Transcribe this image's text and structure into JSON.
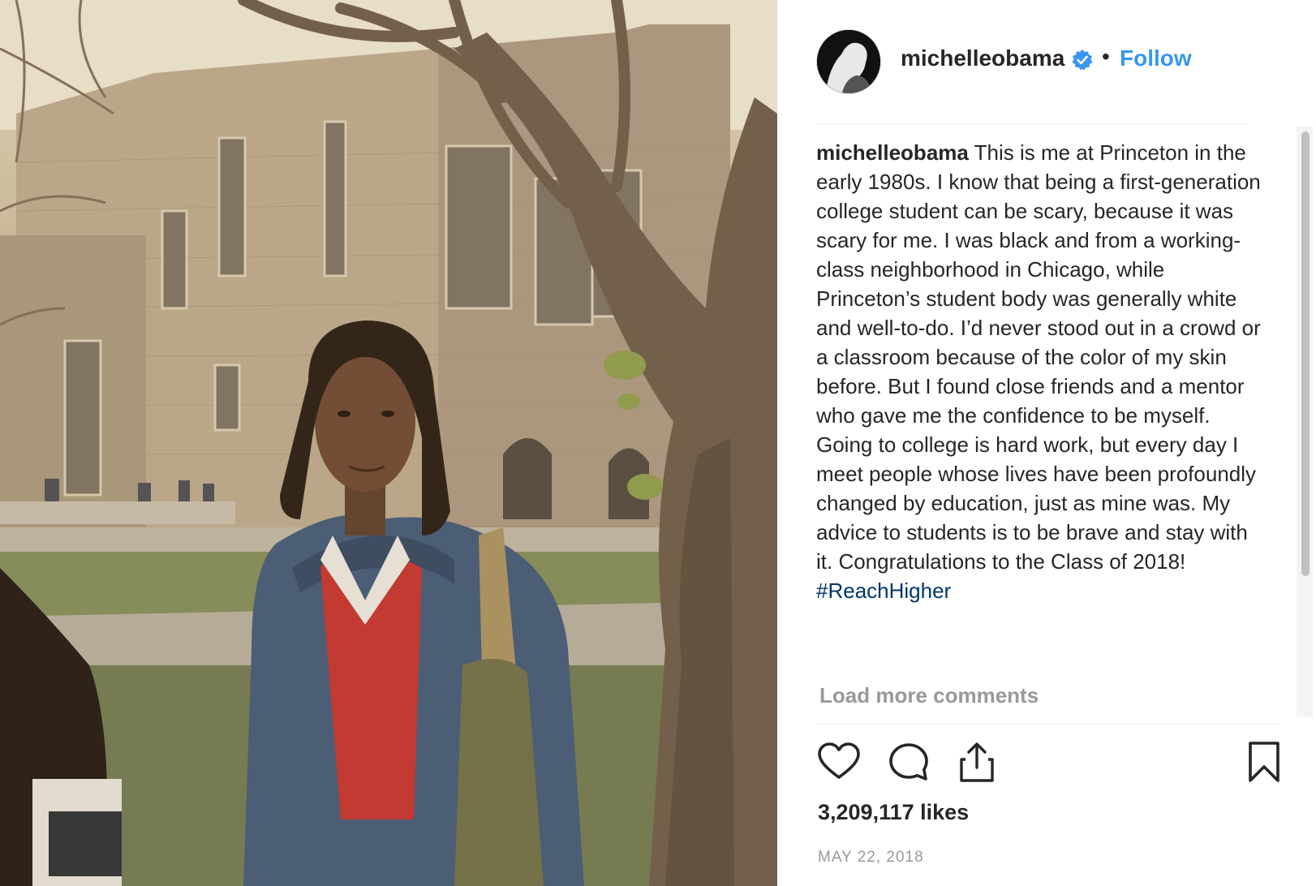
{
  "post": {
    "username": "michelleobama",
    "separator": "•",
    "follow_label": "Follow",
    "caption_user": "michelleobama",
    "caption_text": "This is me at Princeton in the early 1980s. I know that being a first-generation college student can be scary, because it was scary for me. I was black and from a working-class neighborhood in Chicago, while Princeton’s student body was generally white and well-to-do. I’d never stood out in a crowd or a classroom because of the color of my skin before. But I found close friends and a mentor who gave me the confidence to be myself. Going to college is hard work, but every day I meet people whose lives have been profoundly changed by education, just as mine was. My advice to students is to be brave and stay with it. Congratulations to the Class of 2018!",
    "hashtag": "#ReachHigher",
    "load_more_label": "Load more comments",
    "likes": "3,209,117 likes",
    "date": "MAY 22, 2018"
  },
  "icons": {
    "verified": "verified-badge-icon",
    "like": "heart-icon",
    "comment": "comment-bubble-icon",
    "share": "share-icon",
    "save": "bookmark-icon"
  },
  "colors": {
    "accent": "#3897f0",
    "text": "#262626",
    "muted": "#999999",
    "hashtag": "#003569"
  }
}
